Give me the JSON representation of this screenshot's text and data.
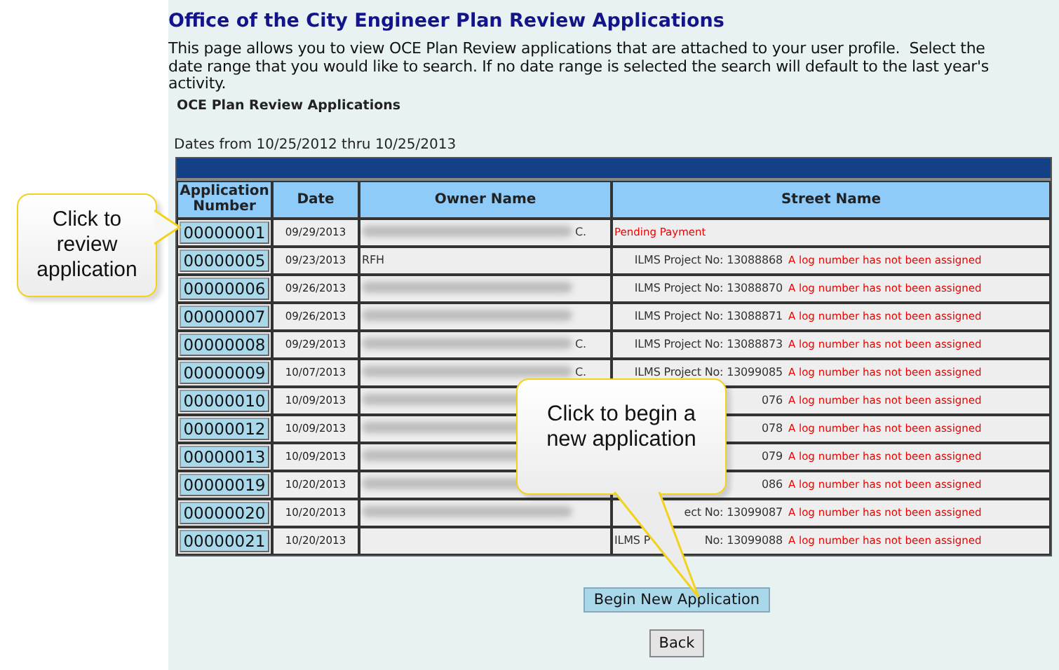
{
  "title": "Office of the City Engineer Plan Review Applications",
  "intro": "This page allows you to view OCE Plan Review applications that are attached to your user profile.  Select the date range that you would like to search. If no date range is selected the search will default to the last year's activity.",
  "section_label": "OCE Plan Review Applications",
  "date_range": "Dates from 10/25/2012 thru 10/25/2013",
  "table": {
    "columns": [
      "Application Number",
      "Date",
      "Owner Name",
      "Street Name"
    ],
    "rows": [
      {
        "number": "00000001",
        "date": "09/29/2013",
        "owner": {
          "redacted": true,
          "text": "C."
        },
        "street": [
          {
            "kind": "warning",
            "text": "Pending Payment"
          }
        ]
      },
      {
        "number": "00000005",
        "date": "09/23/2013",
        "owner": {
          "redacted": false,
          "text": "RFH"
        },
        "street": [
          {
            "kind": "project",
            "text": "ILMS Project No: 13088868"
          },
          {
            "kind": "warning",
            "text": "A log number has not been assigned"
          }
        ]
      },
      {
        "number": "00000006",
        "date": "09/26/2013",
        "owner": {
          "redacted": true
        },
        "street": [
          {
            "kind": "project",
            "text": "ILMS Project No: 13088870"
          },
          {
            "kind": "warning",
            "text": "A log number has not been assigned"
          }
        ]
      },
      {
        "number": "00000007",
        "date": "09/26/2013",
        "owner": {
          "redacted": true
        },
        "street": [
          {
            "kind": "project",
            "text": "ILMS Project No: 13088871"
          },
          {
            "kind": "warning",
            "text": "A log number has not been assigned"
          }
        ]
      },
      {
        "number": "00000008",
        "date": "09/29/2013",
        "owner": {
          "redacted": true,
          "text": "C."
        },
        "street": [
          {
            "kind": "project",
            "text": "ILMS Project No: 13088873"
          },
          {
            "kind": "warning",
            "text": "A log number has not been assigned"
          }
        ]
      },
      {
        "number": "00000009",
        "date": "10/07/2013",
        "owner": {
          "redacted": true,
          "text": "C."
        },
        "street": [
          {
            "kind": "project",
            "text": "ILMS Project No: 13099085"
          },
          {
            "kind": "warning",
            "text": "A log number has not been assigned"
          }
        ]
      },
      {
        "number": "00000010",
        "date": "10/09/2013",
        "owner": {
          "redacted": true
        },
        "street": [
          {
            "kind": "project",
            "text": "076"
          },
          {
            "kind": "warning",
            "text": "A log number has not been assigned"
          }
        ]
      },
      {
        "number": "00000012",
        "date": "10/09/2013",
        "owner": {
          "redacted": true
        },
        "street": [
          {
            "kind": "project",
            "text": "078"
          },
          {
            "kind": "warning",
            "text": "A log number has not been assigned"
          }
        ]
      },
      {
        "number": "00000013",
        "date": "10/09/2013",
        "owner": {
          "redacted": true
        },
        "street": [
          {
            "kind": "project",
            "text": "079"
          },
          {
            "kind": "warning",
            "text": "A log number has not been assigned"
          }
        ]
      },
      {
        "number": "00000019",
        "date": "10/20/2013",
        "owner": {
          "redacted": true
        },
        "street": [
          {
            "kind": "project",
            "text": "086"
          },
          {
            "kind": "warning",
            "text": "A log number has not been assigned"
          }
        ]
      },
      {
        "number": "00000020",
        "date": "10/20/2013",
        "owner": {
          "redacted": true
        },
        "street": [
          {
            "kind": "project",
            "text": "ect No: 13099087"
          },
          {
            "kind": "warning",
            "text": "A log number has not been assigned"
          }
        ]
      },
      {
        "number": "00000021",
        "date": "10/20/2013",
        "owner": {
          "redacted": false
        },
        "street": [
          {
            "kind": "project",
            "text": "ILMS P"
          },
          {
            "kind": "project",
            "text": "No: 13099088"
          },
          {
            "kind": "warning",
            "text": "A log number has not been assigned"
          }
        ]
      }
    ]
  },
  "buttons": [
    {
      "kind": "primary",
      "label": "Begin New Application"
    },
    {
      "kind": "secondary",
      "label": "Back"
    }
  ],
  "callouts": [
    {
      "kind": "left",
      "text": "Click to review application"
    },
    {
      "kind": "down",
      "text": "Click to begin a new application"
    }
  ]
}
